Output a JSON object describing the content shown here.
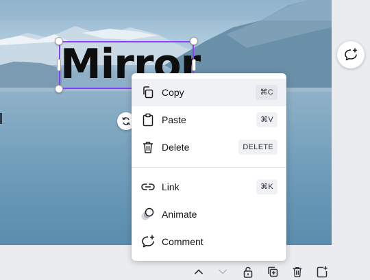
{
  "canvas": {
    "text_element": "Mirror"
  },
  "context_menu": {
    "items": [
      {
        "label": "Copy",
        "shortcut": "⌘C",
        "icon": "copy-icon"
      },
      {
        "label": "Paste",
        "shortcut": "⌘V",
        "icon": "paste-icon"
      },
      {
        "label": "Delete",
        "shortcut": "DELETE",
        "icon": "trash-icon"
      },
      {
        "label": "Link",
        "shortcut": "⌘K",
        "icon": "link-icon"
      },
      {
        "label": "Animate",
        "shortcut": "",
        "icon": "animate-icon"
      },
      {
        "label": "Comment",
        "shortcut": "",
        "icon": "comment-add-icon"
      }
    ]
  },
  "colors": {
    "selection": "#8b3dff",
    "menu_hover": "#f0f1f5"
  },
  "toolbar_icons": [
    "chevron-up-icon",
    "chevron-down-icon",
    "lock-icon",
    "duplicate-icon",
    "trash-icon",
    "add-page-icon"
  ]
}
